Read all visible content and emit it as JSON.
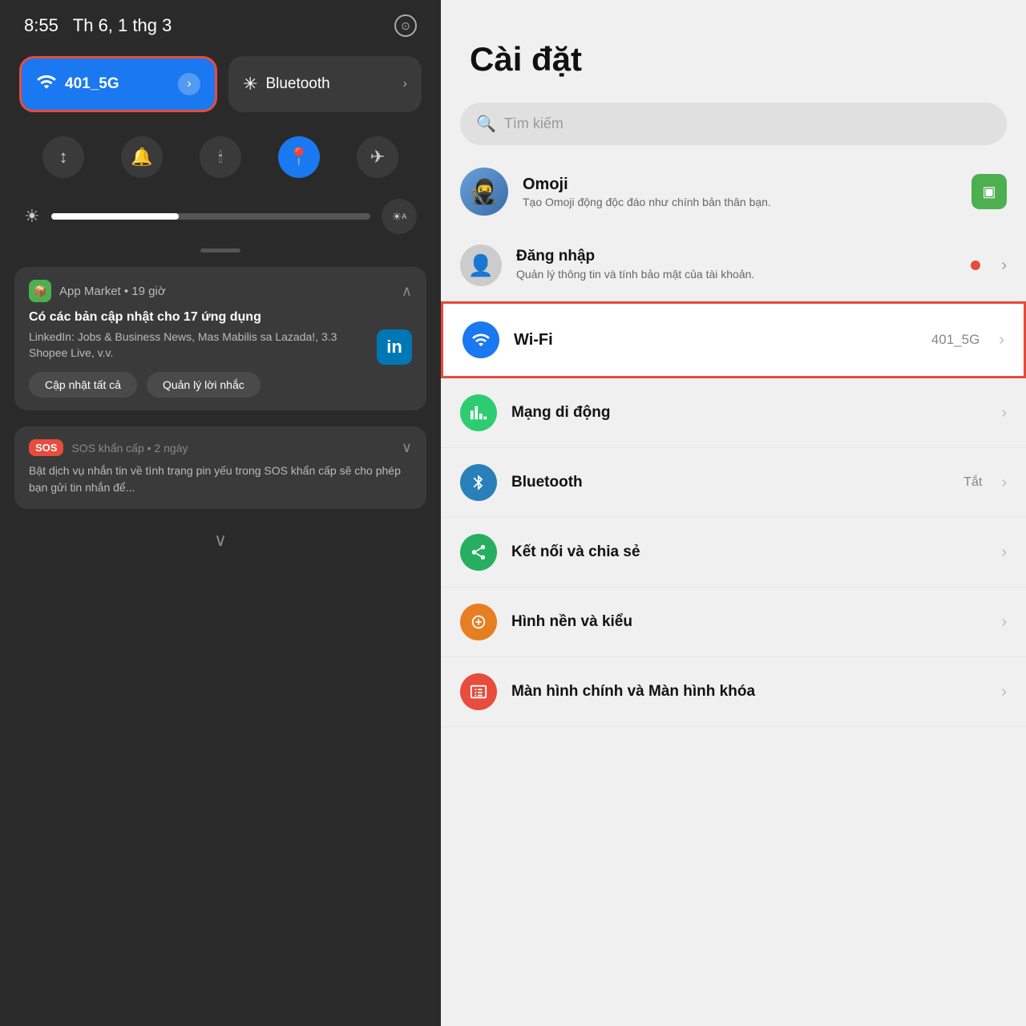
{
  "statusBar": {
    "time": "8:55",
    "date": "Th 6, 1 thg 3",
    "cameraIcon": "⊙"
  },
  "quickTiles": {
    "wifi": {
      "label": "401_5G",
      "arrowIcon": "›"
    },
    "bluetooth": {
      "label": "Bluetooth",
      "arrowIcon": "›"
    }
  },
  "smallIcons": [
    {
      "name": "sound-icon",
      "symbol": "↕",
      "active": false
    },
    {
      "name": "bell-icon",
      "symbol": "🔔",
      "active": false
    },
    {
      "name": "torch-icon",
      "symbol": "🕯",
      "active": false
    },
    {
      "name": "location-icon",
      "symbol": "📍",
      "active": true
    },
    {
      "name": "airplane-icon",
      "symbol": "✈",
      "active": false
    }
  ],
  "brightness": {
    "leftIcon": "☀",
    "rightIcon": "A"
  },
  "notifications": [
    {
      "appName": "App Market",
      "time": "19 giờ",
      "title": "Có các bản cập nhật cho 17 ứng dụng",
      "body": "LinkedIn: Jobs & Business News, Mas Mabilis sa Lazada!, 3.3 Shopee Live, v.v.",
      "actions": [
        "Cập nhật tất cả",
        "Quản lý lời nhắc"
      ],
      "hasLinkedIn": true
    },
    {
      "appName": "SOS khẩn cấp",
      "time": "2 ngày",
      "body": "Bật dịch vụ nhắn tin về tình trạng pin yếu trong SOS khẩn cấp sẽ cho phép bạn gửi tin nhắn để..."
    }
  ],
  "rightPanel": {
    "title": "Cài đặt",
    "search": {
      "placeholder": "Tìm kiếm",
      "icon": "🔍"
    },
    "omoji": {
      "name": "Omoji",
      "desc": "Tạo Omoji động độc đáo như chính bản thân bạn.",
      "emoji": "🥷"
    },
    "login": {
      "name": "Đăng nhập",
      "desc": "Quản lý thông tin và tính bảo mật của tài khoản."
    },
    "settingsItems": [
      {
        "name": "wifi-setting",
        "iconSymbol": "wifi",
        "iconColor": "icon-blue",
        "label": "Wi-Fi",
        "value": "401_5G",
        "highlighted": true
      },
      {
        "name": "mobile-network-setting",
        "iconSymbol": "↕",
        "iconColor": "icon-green",
        "label": "Mạng di động",
        "value": ""
      },
      {
        "name": "bluetooth-setting",
        "iconSymbol": "bluetooth",
        "iconColor": "icon-blue",
        "label": "Bluetooth",
        "value": "Tắt"
      },
      {
        "name": "connection-sharing-setting",
        "iconSymbol": "share",
        "iconColor": "icon-green2",
        "label": "Kết nối và chia sẻ",
        "value": ""
      },
      {
        "name": "wallpaper-setting",
        "iconSymbol": "palette",
        "iconColor": "icon-orange",
        "label": "Hình nền và kiểu",
        "value": ""
      },
      {
        "name": "homescreen-setting",
        "iconSymbol": "screen",
        "iconColor": "icon-red-orange",
        "label": "Màn hình chính và Màn hình khóa",
        "value": ""
      }
    ]
  }
}
